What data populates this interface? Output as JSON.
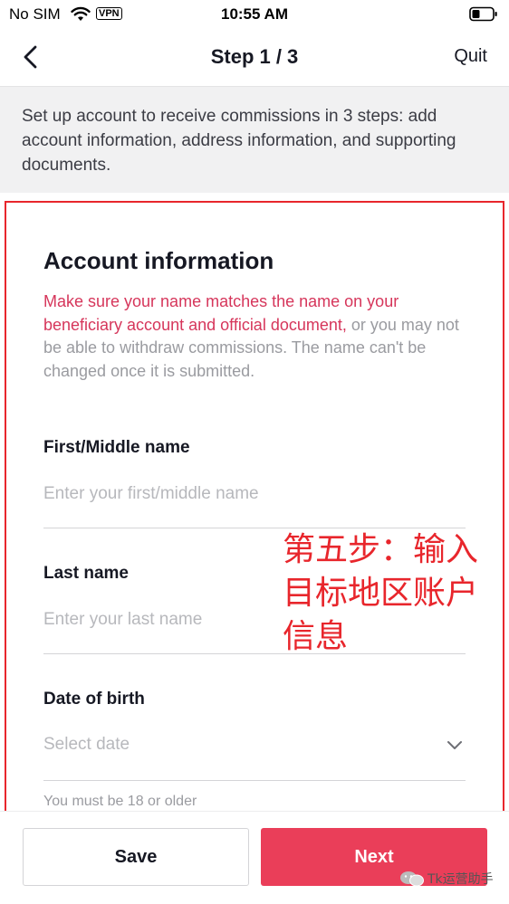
{
  "status_bar": {
    "carrier": "No SIM",
    "vpn_label": "VPN",
    "time": "10:55 AM"
  },
  "nav": {
    "title": "Step 1 / 3",
    "quit_label": "Quit"
  },
  "intro": {
    "text": "Set up account to receive commissions in 3 steps: add account information, address information, and supporting documents."
  },
  "form": {
    "section_title": "Account information",
    "warning_highlight": "Make sure your name matches the name on your beneficiary account and official document,",
    "warning_rest": " or you may not be able to withdraw commissions. The name can't be changed once it is submitted.",
    "first_name": {
      "label": "First/Middle name",
      "placeholder": "Enter your first/middle name",
      "value": ""
    },
    "last_name": {
      "label": "Last name",
      "placeholder": "Enter your last name",
      "value": ""
    },
    "date_of_birth": {
      "label": "Date of birth",
      "placeholder": "Select date",
      "hint": "You must be 18 or older"
    }
  },
  "annotation": {
    "text": "第五步：输入目标地区账户信息"
  },
  "actions": {
    "save_label": "Save",
    "next_label": "Next"
  },
  "watermark": {
    "text": "Tk运营助手"
  },
  "colors": {
    "primary": "#ea3e59",
    "warning_highlight": "#d6365b",
    "annotation": "#e8262c",
    "intro_background": "#f1f1f2"
  }
}
